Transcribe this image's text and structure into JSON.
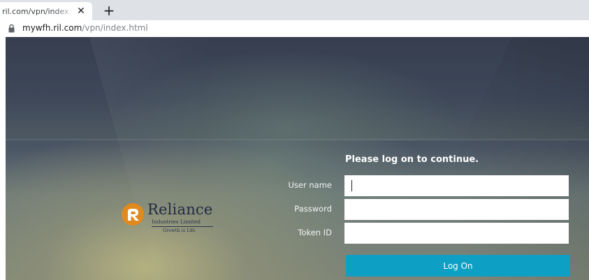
{
  "browser": {
    "tab_title": "ril.com/vpn/index",
    "url_host": "mywfh.ril.com",
    "url_path": "/vpn/index.html"
  },
  "logo": {
    "name": "Reliance",
    "subtitle": "Industries Limited",
    "tagline": "Growth is Life"
  },
  "form": {
    "heading": "Please log on to continue.",
    "username_label": "User name",
    "password_label": "Password",
    "token_label": "Token ID",
    "username_value": "",
    "password_value": "",
    "token_value": "",
    "submit_label": "Log On"
  },
  "colors": {
    "button": "#0d9fc4",
    "logo_mark": "#e08a1e",
    "logo_text": "#1f2a44"
  },
  "icons": {
    "lock": "lock-icon",
    "close": "close-icon",
    "new_tab": "plus-icon",
    "logo_mark": "reliance-logo-icon"
  }
}
